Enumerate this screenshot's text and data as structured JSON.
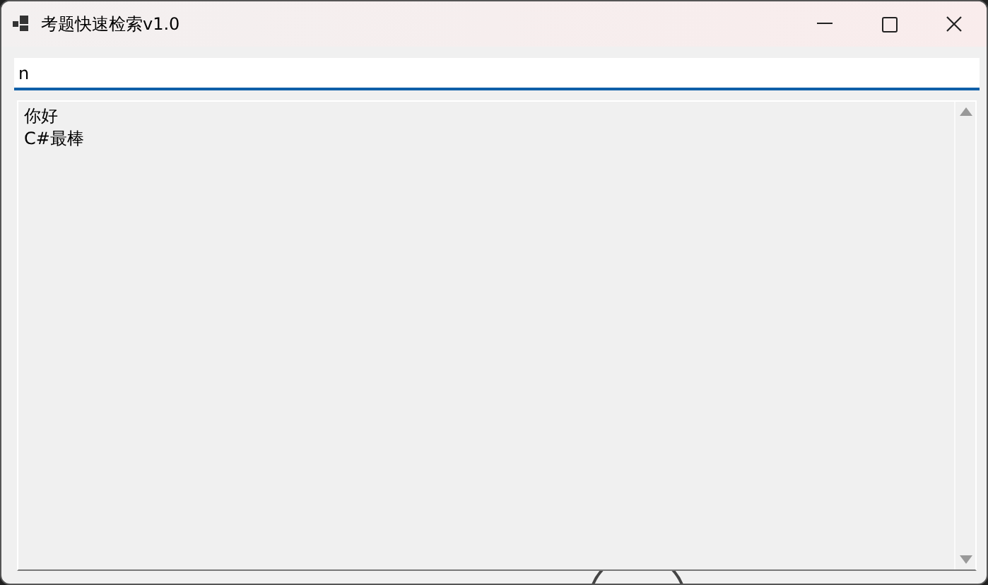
{
  "window": {
    "title": "考题快速检索v1.0"
  },
  "search": {
    "value": "n"
  },
  "results": [
    {
      "text": "你好"
    },
    {
      "text": "C#最棒"
    }
  ]
}
